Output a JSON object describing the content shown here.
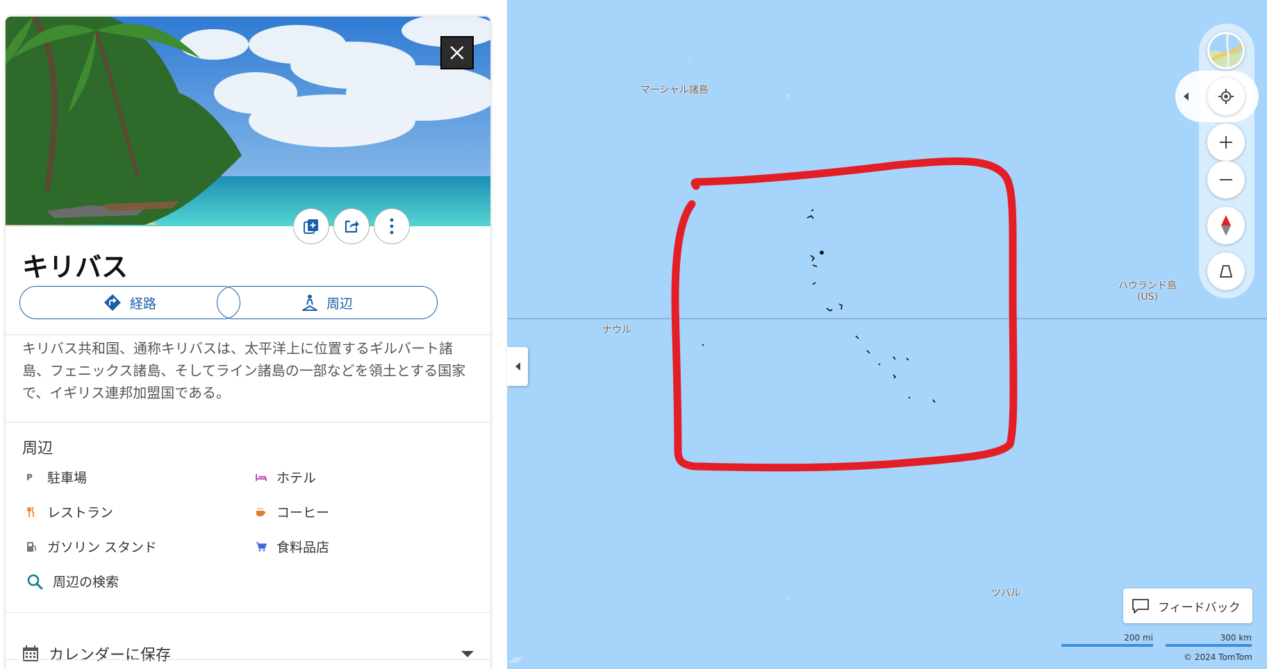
{
  "place": {
    "title": "キリバス",
    "description": "キリバス共和国、通称キリバスは、太平洋上に位置するギルバート諸島、フェニックス諸島、そしてライン諸島の一部などを領土とする国家で、イギリス連邦加盟国である。"
  },
  "actions": {
    "route_label": "経路",
    "nearby_label": "周辺"
  },
  "icons": {
    "close": "close-icon",
    "save": "add-to-collection-icon",
    "share": "share-icon",
    "more": "more-vertical-icon",
    "route": "directions-icon",
    "nearby": "nearby-person-icon",
    "search": "search-icon",
    "calendar": "calendar-icon",
    "layers": "map-layers-icon",
    "locate": "locate-me-icon",
    "zoom_in": "plus-icon",
    "zoom_out": "minus-icon",
    "compass": "compass-icon",
    "tilt": "3d-tilt-icon",
    "feedback": "chat-bubble-icon"
  },
  "nearby": {
    "heading": "周辺",
    "items": [
      {
        "label": "駐車場",
        "icon": "parking-icon",
        "color": "#666666"
      },
      {
        "label": "ホテル",
        "icon": "hotel-icon",
        "color": "#c04fb0"
      },
      {
        "label": "レストラン",
        "icon": "restaurant-icon",
        "color": "#e07b2a"
      },
      {
        "label": "コーヒー",
        "icon": "coffee-icon",
        "color": "#e07b2a"
      },
      {
        "label": "ガソリン スタンド",
        "icon": "gas-station-icon",
        "color": "#666666"
      },
      {
        "label": "食料品店",
        "icon": "grocery-icon",
        "color": "#3b6bd6"
      }
    ],
    "search_label": "周辺の検索"
  },
  "calendar": {
    "label": "カレンダーに保存"
  },
  "map": {
    "labels": {
      "marshall": "マーシャル諸島",
      "nauru": "ナウル",
      "howland_line1": "ハウランド島",
      "howland_line2": "(US)",
      "tuvalu": "ツバル"
    },
    "feedback_label": "フィードバック",
    "scale_mi": "200 mi",
    "scale_km": "300 km",
    "copyright": "© 2024 TomTom"
  },
  "colors": {
    "accent": "#1a5ea8",
    "ocean": "#a6d4fb",
    "annotation": "#e41e26"
  }
}
